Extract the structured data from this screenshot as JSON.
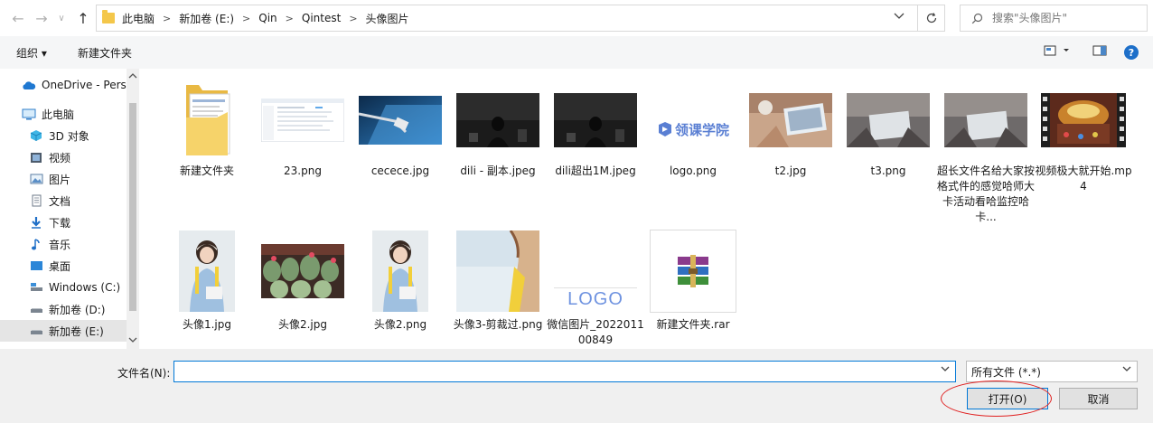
{
  "nav": {
    "back_glyph": "←",
    "forward_glyph": "→",
    "recent_glyph": "∨",
    "up_glyph": "↑"
  },
  "address": {
    "crumbs": [
      "此电脑",
      "新加卷 (E:)",
      "Qin",
      "Qintest",
      "头像图片"
    ],
    "separator": ">"
  },
  "search": {
    "placeholder": "搜索\"头像图片\""
  },
  "toolbar": {
    "organize_label": "组织 ▾",
    "new_folder_label": "新建文件夹",
    "help_glyph": "?"
  },
  "sidebar": {
    "items": [
      {
        "label": "OneDrive - Perso",
        "icon": "cloud-icon"
      },
      {
        "label": "此电脑",
        "icon": "computer-icon"
      },
      {
        "label": "3D 对象",
        "icon": "cube-icon"
      },
      {
        "label": "视频",
        "icon": "video-icon"
      },
      {
        "label": "图片",
        "icon": "picture-icon"
      },
      {
        "label": "文档",
        "icon": "document-icon"
      },
      {
        "label": "下载",
        "icon": "download-icon"
      },
      {
        "label": "音乐",
        "icon": "music-icon"
      },
      {
        "label": "桌面",
        "icon": "desktop-icon"
      },
      {
        "label": "Windows (C:)",
        "icon": "drive-icon"
      },
      {
        "label": "新加卷 (D:)",
        "icon": "drive-icon"
      },
      {
        "label": "新加卷 (E:)",
        "icon": "drive-icon",
        "selected": true
      }
    ]
  },
  "files": [
    {
      "name": "新建文件夹",
      "kind": "folder"
    },
    {
      "name": "23.png",
      "kind": "screenshot"
    },
    {
      "name": "cecece.jpg",
      "kind": "photo-blue"
    },
    {
      "name": "dili - 副本.jpeg",
      "kind": "photo-dark"
    },
    {
      "name": "dili超出1M.jpeg",
      "kind": "photo-dark"
    },
    {
      "name": "logo.png",
      "kind": "logo",
      "logo_text": "领课学院"
    },
    {
      "name": "t2.jpg",
      "kind": "photo-warm"
    },
    {
      "name": "t3.png",
      "kind": "photo-laptop"
    },
    {
      "name": "超长文件名给大家按格式件的感觉哈师大卡活动看哈监控哈卡...",
      "kind": "photo-laptop"
    },
    {
      "name": "视频极大就开始.mp4",
      "kind": "video"
    },
    {
      "name": "头像1.jpg",
      "kind": "photo-portrait"
    },
    {
      "name": "头像2.jpg",
      "kind": "photo-cactus"
    },
    {
      "name": "头像2.png",
      "kind": "photo-portrait"
    },
    {
      "name": "头像3-剪裁过.png",
      "kind": "photo-soft"
    },
    {
      "name": "微信图片_202201100849",
      "kind": "logo-text",
      "logo_text": "LOGO"
    },
    {
      "name": "新建文件夹.rar",
      "kind": "rar"
    }
  ],
  "bottom": {
    "filename_label": "文件名(N):",
    "filename_value": "",
    "filetype_value": "所有文件 (*.*)",
    "open_label": "打开(O)",
    "cancel_label": "取消"
  },
  "colors": {
    "accent": "#0078d7",
    "annotation_red": "#e02020",
    "folder_yellow": "#f4c74a"
  }
}
